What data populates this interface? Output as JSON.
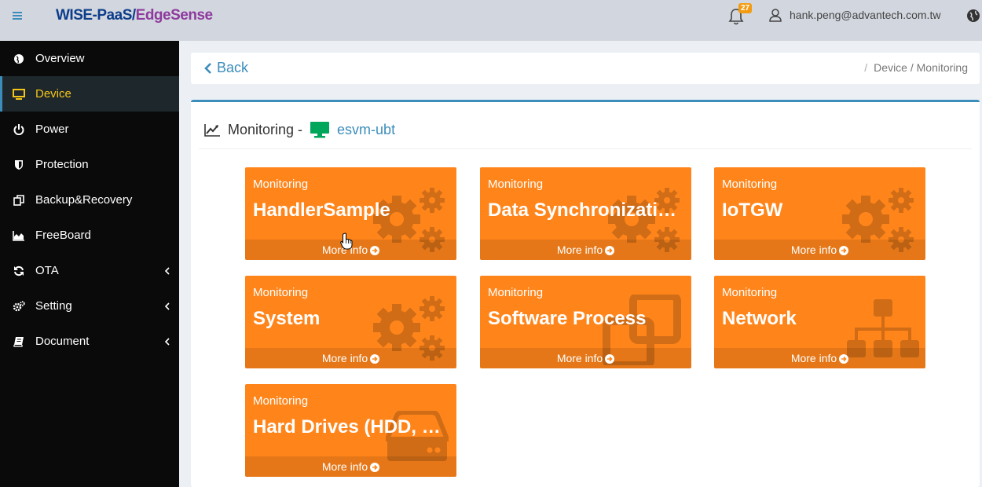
{
  "header": {
    "brand_part1": "WISE-PaaS/",
    "brand_part2": "EdgeSense",
    "notification_count": "27",
    "user_email": "hank.peng@advantech.com.tw"
  },
  "sidebar": {
    "items": [
      {
        "label": "Overview",
        "icon": "globe-icon"
      },
      {
        "label": "Device",
        "icon": "monitor-icon",
        "active": true
      },
      {
        "label": "Power",
        "icon": "power-icon"
      },
      {
        "label": "Protection",
        "icon": "shield-icon"
      },
      {
        "label": "Backup&Recovery",
        "icon": "copy-icon"
      },
      {
        "label": "FreeBoard",
        "icon": "area-chart-icon"
      },
      {
        "label": "OTA",
        "icon": "refresh-icon",
        "expandable": true
      },
      {
        "label": "Setting",
        "icon": "gears-icon",
        "expandable": true
      },
      {
        "label": "Document",
        "icon": "book-icon",
        "expandable": true
      }
    ]
  },
  "topbar": {
    "back_label": "Back",
    "breadcrumb_separator": "/",
    "breadcrumb": "Device / Monitoring"
  },
  "main": {
    "title": "Monitoring -",
    "device_name": "esvm-ubt",
    "tiles": [
      {
        "caption": "Monitoring",
        "title": "HandlerSample",
        "footer": "More info",
        "icon": "gears-icon"
      },
      {
        "caption": "Monitoring",
        "title": "Data Synchronization",
        "footer": "More info",
        "icon": "gears-icon"
      },
      {
        "caption": "Monitoring",
        "title": "IoTGW",
        "footer": "More info",
        "icon": "gears-icon"
      },
      {
        "caption": "Monitoring",
        "title": "System",
        "footer": "More info",
        "icon": "gears-icon"
      },
      {
        "caption": "Monitoring",
        "title": "Software Process",
        "footer": "More info",
        "icon": "clone-icon"
      },
      {
        "caption": "Monitoring",
        "title": "Network",
        "footer": "More info",
        "icon": "sitemap-icon"
      },
      {
        "caption": "Monitoring",
        "title": "Hard Drives (HDD, SSD)",
        "footer": "More info",
        "icon": "hdd-icon"
      }
    ]
  },
  "colors": {
    "tile": "#ff851b",
    "accent": "#3c8dbc",
    "sidebar": "#0a0a0a",
    "active_text": "#f5c518"
  }
}
